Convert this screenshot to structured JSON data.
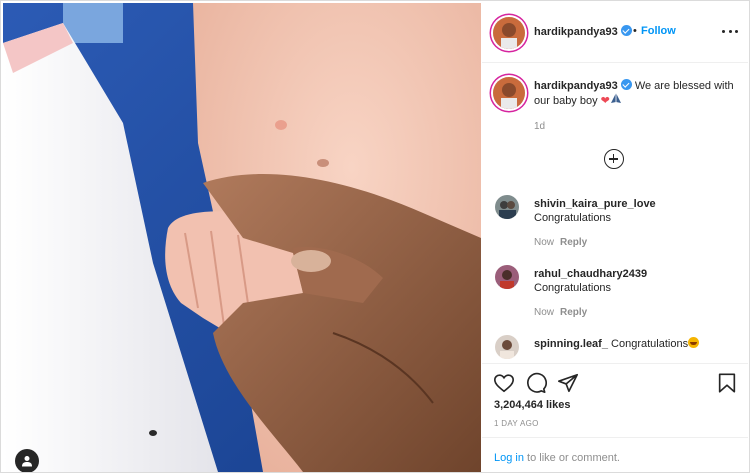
{
  "post": {
    "username": "hardikpandya93",
    "verified": true,
    "follow_separator": "•",
    "follow_label": "Follow",
    "more_icon": "more-options-icon",
    "caption": {
      "text": "We are blessed with our baby boy",
      "emojis": [
        "red-heart",
        "folded-hands"
      ],
      "time": "1d"
    },
    "load_more_icon": "plus-circle-icon"
  },
  "comments": [
    {
      "username": "shivin_kaira_pure_love",
      "text": "Congratulations",
      "time": "Now",
      "reply_label": "Reply"
    },
    {
      "username": "rahul_chaudhary2439",
      "text": "Congratulations",
      "time": "Now",
      "reply_label": "Reply"
    },
    {
      "username": "spinning.leaf_",
      "text": "Congratulations",
      "emoji": "smiling-face"
    }
  ],
  "actions": {
    "icons": [
      "like-heart-icon",
      "comment-icon",
      "share-icon",
      "save-bookmark-icon"
    ],
    "likes": "3,204,464 likes",
    "posted_ago": "1 day ago"
  },
  "footer": {
    "login_label": "Log in",
    "rest_text": "to like or comment."
  },
  "colors": {
    "link_blue": "#0095f6",
    "verified_blue": "#3897f0",
    "heart_red": "#ed4956",
    "secondary_text": "#8e8e8e"
  }
}
